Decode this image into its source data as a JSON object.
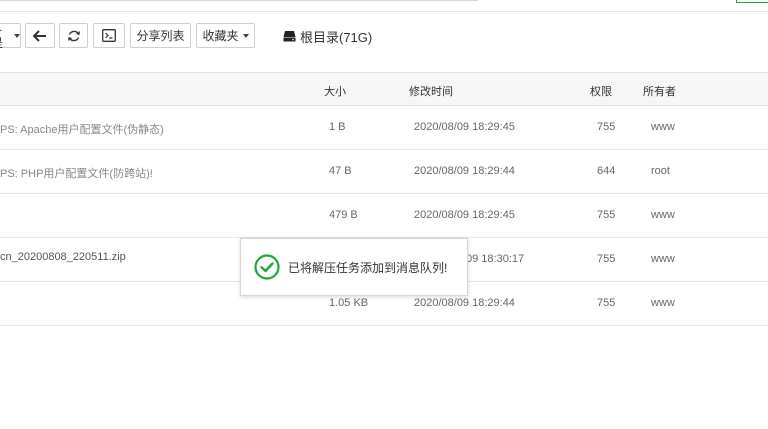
{
  "toolbar": {
    "partial_button_label": "…是",
    "share_list_label": "分享列表",
    "favorites_label": "收藏夹",
    "path_label": "根目录(71G)",
    "icons": [
      "back-arrow-icon",
      "refresh-icon",
      "terminal-icon",
      "disk-icon"
    ]
  },
  "table": {
    "columns": {
      "size": "大小",
      "modified": "修改时间",
      "permission": "权限",
      "owner": "所有者"
    },
    "rows": [
      {
        "name": "PS: Apache用户配置文件(伪静态)",
        "size": "1 B",
        "modified": "2020/08/09 18:29:45",
        "permission": "755",
        "owner": "www"
      },
      {
        "name": "PS: PHP用户配置文件(防跨站)!",
        "size": "47 B",
        "modified": "2020/08/09 18:29:44",
        "permission": "644",
        "owner": "root"
      },
      {
        "name": "",
        "size": "479 B",
        "modified": "2020/08/09 18:29:45",
        "permission": "755",
        "owner": "www"
      },
      {
        "name": "cn_20200808_220511.zip",
        "size": "",
        "modified": "09 18:30:17",
        "permission": "755",
        "owner": "www"
      },
      {
        "name": "",
        "size": "1.05 KB",
        "modified": "2020/08/09 18:29:44",
        "permission": "755",
        "owner": "www"
      }
    ]
  },
  "toast": {
    "message": "已将解压任务添加到消息队列!",
    "icon": "check-circle-icon",
    "color": "#20a53a"
  }
}
